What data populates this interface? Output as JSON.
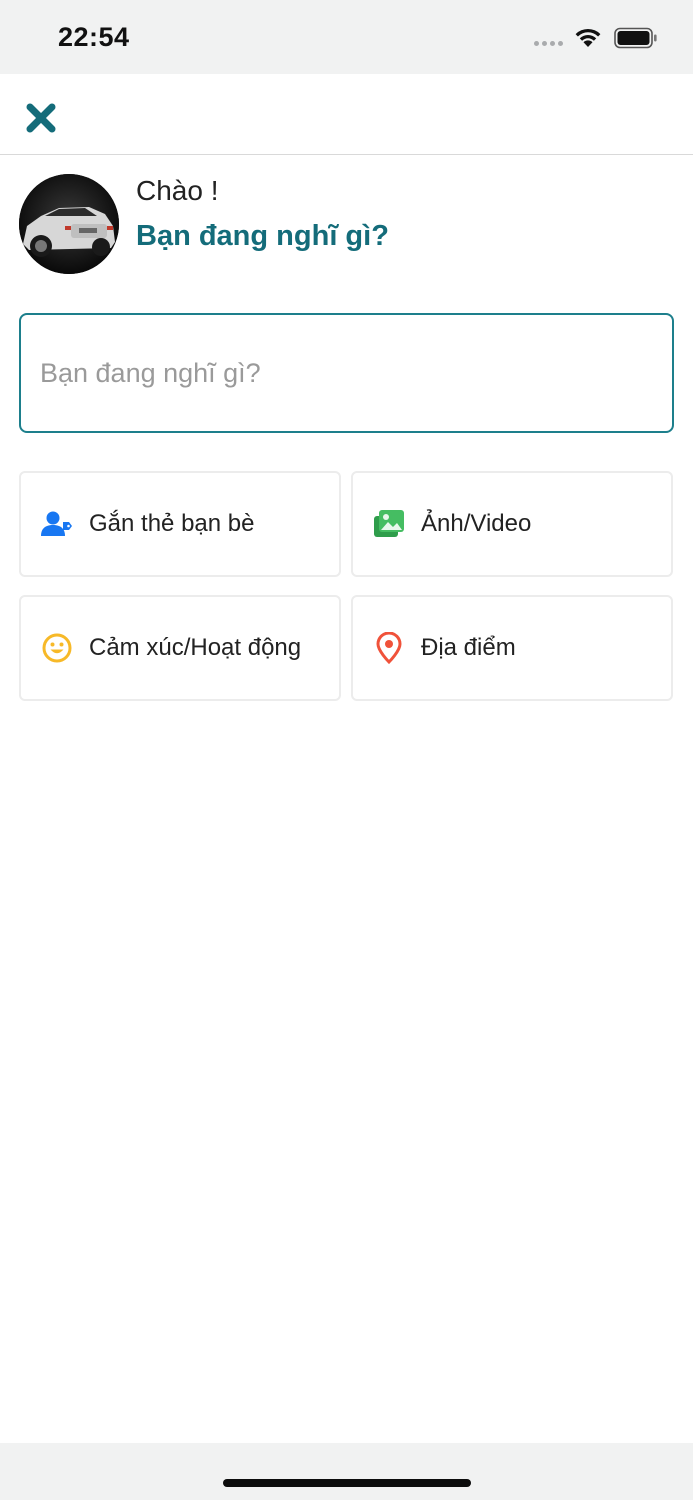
{
  "status_bar": {
    "time": "22:54"
  },
  "header": {
    "close_icon": "close-icon",
    "accent_color": "#146c7a"
  },
  "profile": {
    "greeting": "Chào !",
    "prompt": "Bạn đang nghĩ gì?"
  },
  "composer": {
    "placeholder": "Bạn đang nghĩ gì?",
    "value": ""
  },
  "actions": [
    {
      "label": "Gắn thẻ bạn bè",
      "icon": "tag-friends-icon",
      "color": "#1877f2"
    },
    {
      "label": "Ảnh/Video",
      "icon": "photo-icon",
      "color": "#45bd62"
    },
    {
      "label": "Cảm xúc/Hoạt động",
      "icon": "smiley-icon",
      "color": "#f7b928"
    },
    {
      "label": "Địa điểm",
      "icon": "location-pin-icon",
      "color": "#f02849"
    }
  ]
}
